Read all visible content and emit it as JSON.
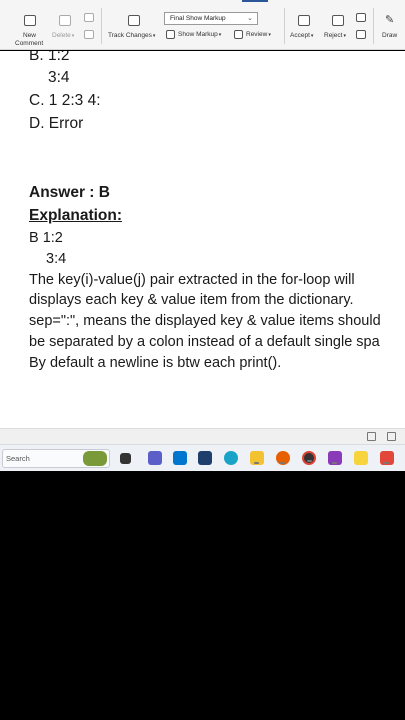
{
  "ribbon": {
    "new_comment": "New",
    "new_comment_2": "Comment",
    "delete": "Delete",
    "track_changes": "Track Changes",
    "markup_select": "Final Show Markup",
    "show_markup": "Show Markup",
    "review": "Review",
    "accept": "Accept",
    "reject": "Reject",
    "draw": "Draw"
  },
  "document": {
    "lines": [
      "B. 1:2",
      "3:4",
      "C. 1 2:3 4:",
      "D. Error",
      "Answer : B",
      "Explanation:",
      "B  1:2",
      "3:4",
      "The key(i)-value(j) pair extracted in the for-loop will",
      "displays each key & value item from the dictionary.",
      "sep=\":\", means the displayed key & value items should",
      "be separated by a colon instead of a default single spa",
      "By default a newline is btw each print()."
    ]
  },
  "taskbar": {
    "search_label": "Search"
  },
  "colors": {
    "accent": "#2b579a",
    "ribbon_bg": "#f5f5f5",
    "taskbar_bg": "#eef1f5"
  }
}
